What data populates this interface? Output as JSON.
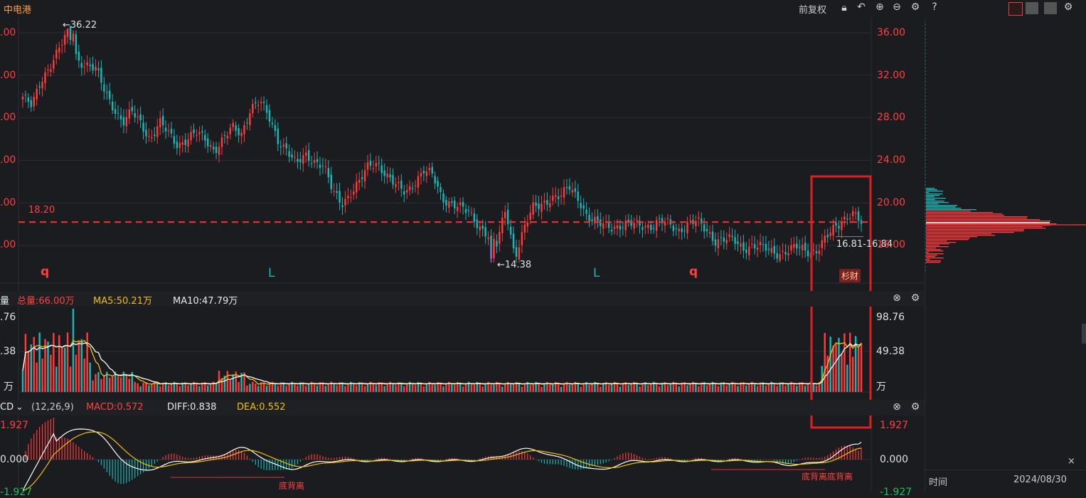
{
  "header": {
    "title": "中电港",
    "adjust_label": "前复权"
  },
  "price_panel": {
    "high_marker": "←36.22",
    "low_marker": "←14.38",
    "ref_line_label": "18.20",
    "range_label": "16.81-16.84",
    "axis_ticks": [
      "36.00",
      "32.00",
      "28.00",
      "24.00",
      "20.00",
      "16.00"
    ],
    "left_axis_ticks": [
      ".00",
      ".00",
      ".00",
      ".00",
      ".00",
      ".00"
    ],
    "signals": [
      "q",
      "L",
      "L",
      "q"
    ],
    "tag": "杉财"
  },
  "volume_panel": {
    "name": "量",
    "total_label": "总量:66.00万",
    "ma5_label": "MA5:50.21万",
    "ma10_label": "MA10:47.79万",
    "axis_ticks": [
      "98.76",
      "49.38",
      "万"
    ],
    "left_axis_ticks": [
      ".76",
      ".38",
      "万"
    ]
  },
  "macd_panel": {
    "name": "CD",
    "params": "(12,26,9)",
    "macd_label": "MACD:0.572",
    "diff_label": "DIFF:0.838",
    "dea_label": "DEA:0.552",
    "axis_ticks": [
      "1.927",
      "0.000",
      "-1.927"
    ],
    "left_axis_ticks": [
      "1.927",
      "0.000",
      "-1.927"
    ],
    "annotation_1": "底背离",
    "annotation_2": "底背离底背离"
  },
  "sidebar": {
    "time_label": "时间",
    "date": "2024/08/30",
    "close_label": "×"
  },
  "colors": {
    "up": "#ff3b3b",
    "down": "#17b8b8",
    "ma5": "#f0c000",
    "ma10": "#ffffff",
    "highlight_box": "#e02020"
  },
  "chart_data": {
    "type": "candlestick",
    "price_ylim": [
      13.5,
      37.0
    ],
    "high": 36.22,
    "low": 14.38,
    "reference_line": 18.2,
    "latest_range": [
      16.81,
      16.84
    ],
    "volume_ylim": [
      0,
      98.76
    ],
    "volume_unit": "万",
    "volume_total": 66.0,
    "volume_ma5": 50.21,
    "volume_ma10": 47.79,
    "macd": 0.572,
    "diff": 0.838,
    "dea": 0.552,
    "macd_ylim": [
      -1.927,
      1.927
    ],
    "close_path": [
      30.0,
      29.0,
      31.5,
      33.0,
      34.5,
      36.0,
      33.5,
      33.0,
      32.5,
      30.5,
      29.0,
      27.5,
      28.5,
      27.5,
      26.0,
      27.5,
      26.5,
      25.5,
      26.0,
      26.5,
      26.0,
      25.0,
      26.0,
      27.0,
      26.5,
      29.0,
      29.5,
      28.0,
      26.0,
      25.0,
      23.5,
      24.5,
      24.0,
      23.5,
      21.0,
      20.0,
      21.0,
      22.0,
      23.5,
      23.8,
      22.5,
      21.5,
      21.0,
      22.0,
      23.0,
      22.5,
      20.5,
      20.0,
      19.5,
      19.0,
      18.0,
      17.0,
      16.0,
      19.5,
      15.0,
      17.5,
      19.5,
      20.0,
      20.5,
      20.5,
      21.5,
      20.5,
      18.5,
      18.0,
      18.0,
      17.8,
      17.8,
      18.0,
      18.0,
      17.8,
      18.2,
      18.0,
      17.5,
      18.0,
      18.2,
      17.5,
      16.5,
      16.5,
      16.5,
      15.8,
      16.0,
      15.8,
      15.5,
      15.3,
      15.5,
      15.8,
      15.5,
      15.5,
      16.5,
      17.5,
      18.5,
      19.2,
      18.0
    ]
  }
}
